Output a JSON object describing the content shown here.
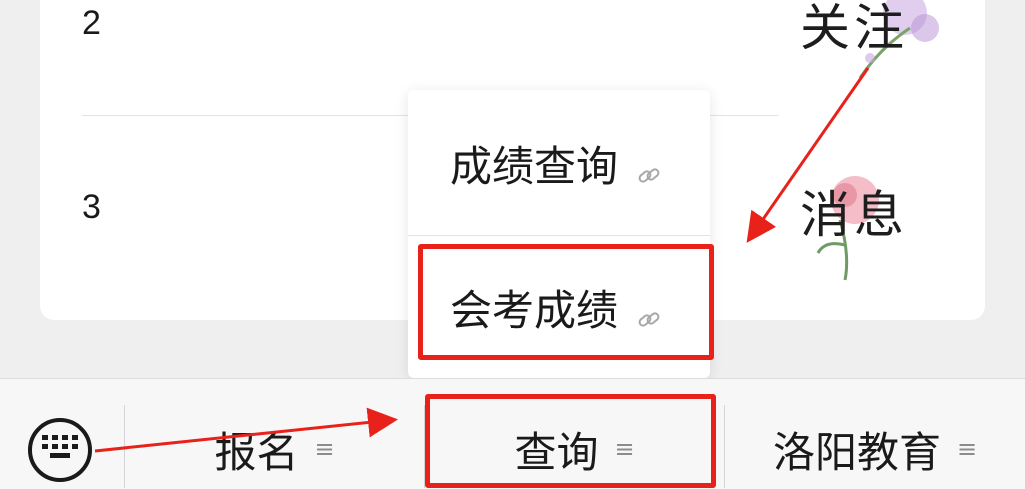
{
  "list": {
    "rows": [
      {
        "number": "2",
        "decor_text": "关注"
      },
      {
        "number": "3",
        "decor_text": "消息"
      }
    ]
  },
  "popup_menu": {
    "items": [
      {
        "label": "成绩查询",
        "icon": "link-icon"
      },
      {
        "label": "会考成绩",
        "icon": "link-icon"
      }
    ]
  },
  "bottom_menu": {
    "keyboard_icon": "keyboard-icon",
    "tabs": [
      {
        "label": "报名",
        "icon": "menu-lines-icon"
      },
      {
        "label": "查询",
        "icon": "menu-lines-icon"
      },
      {
        "label": "洛阳教育",
        "icon": "menu-lines-icon"
      }
    ]
  },
  "annotations": {
    "highlight_color": "#e8211a"
  }
}
